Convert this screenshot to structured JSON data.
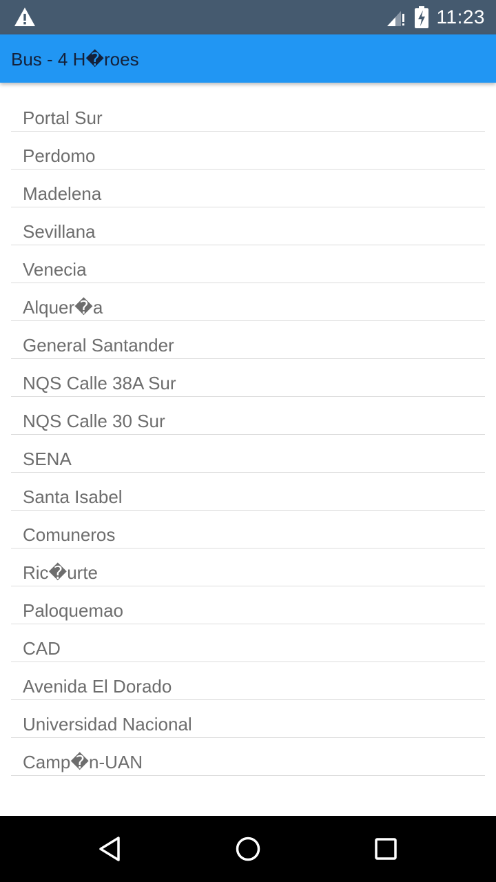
{
  "status_bar": {
    "time": "11:23",
    "icons": [
      "warning-icon",
      "signal-icon",
      "battery-charging-icon"
    ]
  },
  "app_bar": {
    "title": "Bus - 4 H�roes",
    "background_color": "#2196f3"
  },
  "stops": [
    "Portal Sur",
    "Perdomo",
    "Madelena",
    "Sevillana",
    "Venecia",
    "Alquer�a",
    "General Santander",
    "NQS Calle 38A Sur",
    "NQS Calle 30 Sur",
    "SENA",
    "Santa Isabel",
    "Comuneros",
    "Ric�urte",
    "Paloquemao",
    "CAD",
    "Avenida El Dorado",
    "Universidad Nacional",
    "Camp�n-UAN"
  ],
  "nav_bar": {
    "icons": [
      "back-icon",
      "home-icon",
      "recents-icon"
    ]
  }
}
